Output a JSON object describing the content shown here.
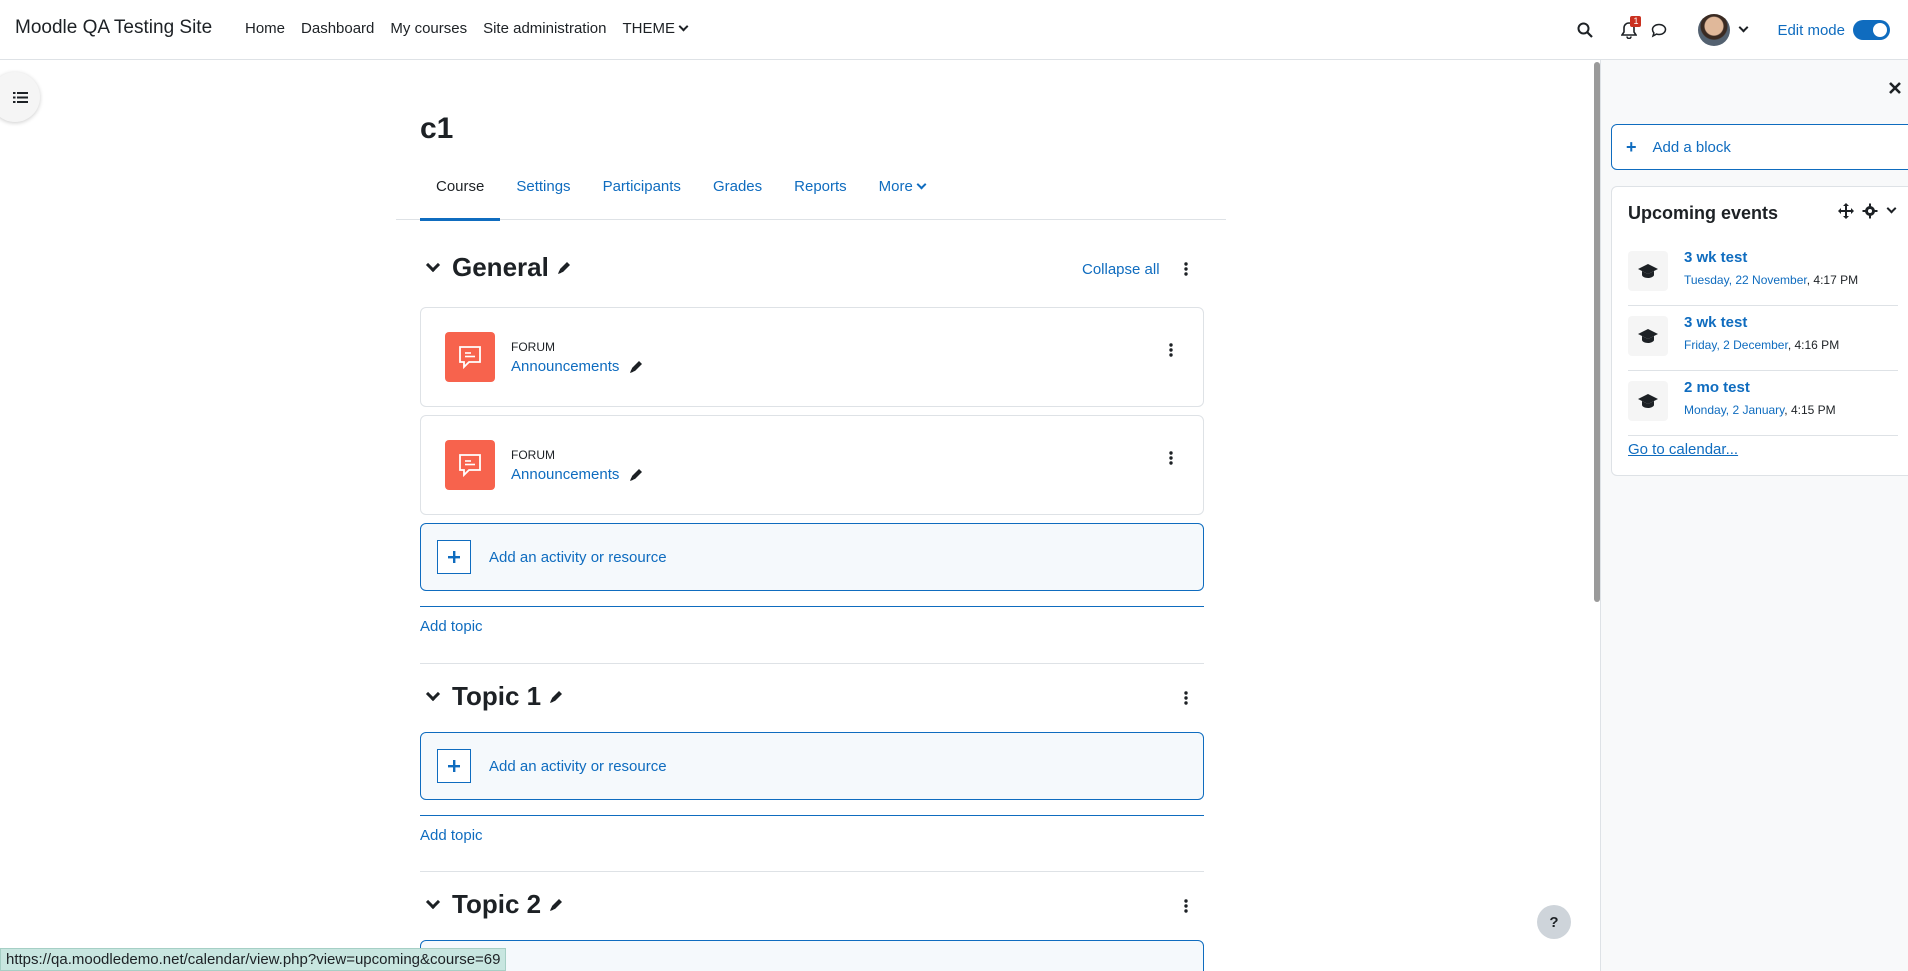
{
  "navbar": {
    "brand": "Moodle QA Testing Site",
    "links": [
      "Home",
      "Dashboard",
      "My courses",
      "Site administration",
      "THEME"
    ],
    "notification_count": "1",
    "edit_mode_label": "Edit mode"
  },
  "course": {
    "title": "c1",
    "tabs": [
      "Course",
      "Settings",
      "Participants",
      "Grades",
      "Reports",
      "More"
    ],
    "active_tab": "Course",
    "collapse_all": "Collapse all"
  },
  "sections": [
    {
      "title": "General",
      "activities": [
        {
          "type": "Forum",
          "name": "Announcements"
        },
        {
          "type": "Forum",
          "name": "Announcements"
        }
      ],
      "add_activity": "Add an activity or resource",
      "add_topic": "Add topic"
    },
    {
      "title": "Topic 1",
      "activities": [],
      "add_activity": "Add an activity or resource",
      "add_topic": "Add topic"
    },
    {
      "title": "Topic 2",
      "activities": []
    }
  ],
  "right_drawer": {
    "add_block": "Add a block",
    "upcoming": {
      "title": "Upcoming events",
      "events": [
        {
          "name": "3 wk test",
          "day": "Tuesday, 22 November",
          "time": ", 4:17 PM"
        },
        {
          "name": "3 wk test",
          "day": "Friday, 2 December",
          "time": ", 4:16 PM"
        },
        {
          "name": "2 mo test",
          "day": "Monday, 2 January",
          "time": ", 4:15 PM"
        }
      ],
      "go_calendar": "Go to calendar..."
    }
  },
  "help_label": "?",
  "status_url": "https://qa.moodledemo.net/calendar/view.php?view=upcoming&course=69",
  "colors": {
    "link": "#0f6cbf",
    "forum": "#f7634d",
    "badge": "#ca3120"
  }
}
